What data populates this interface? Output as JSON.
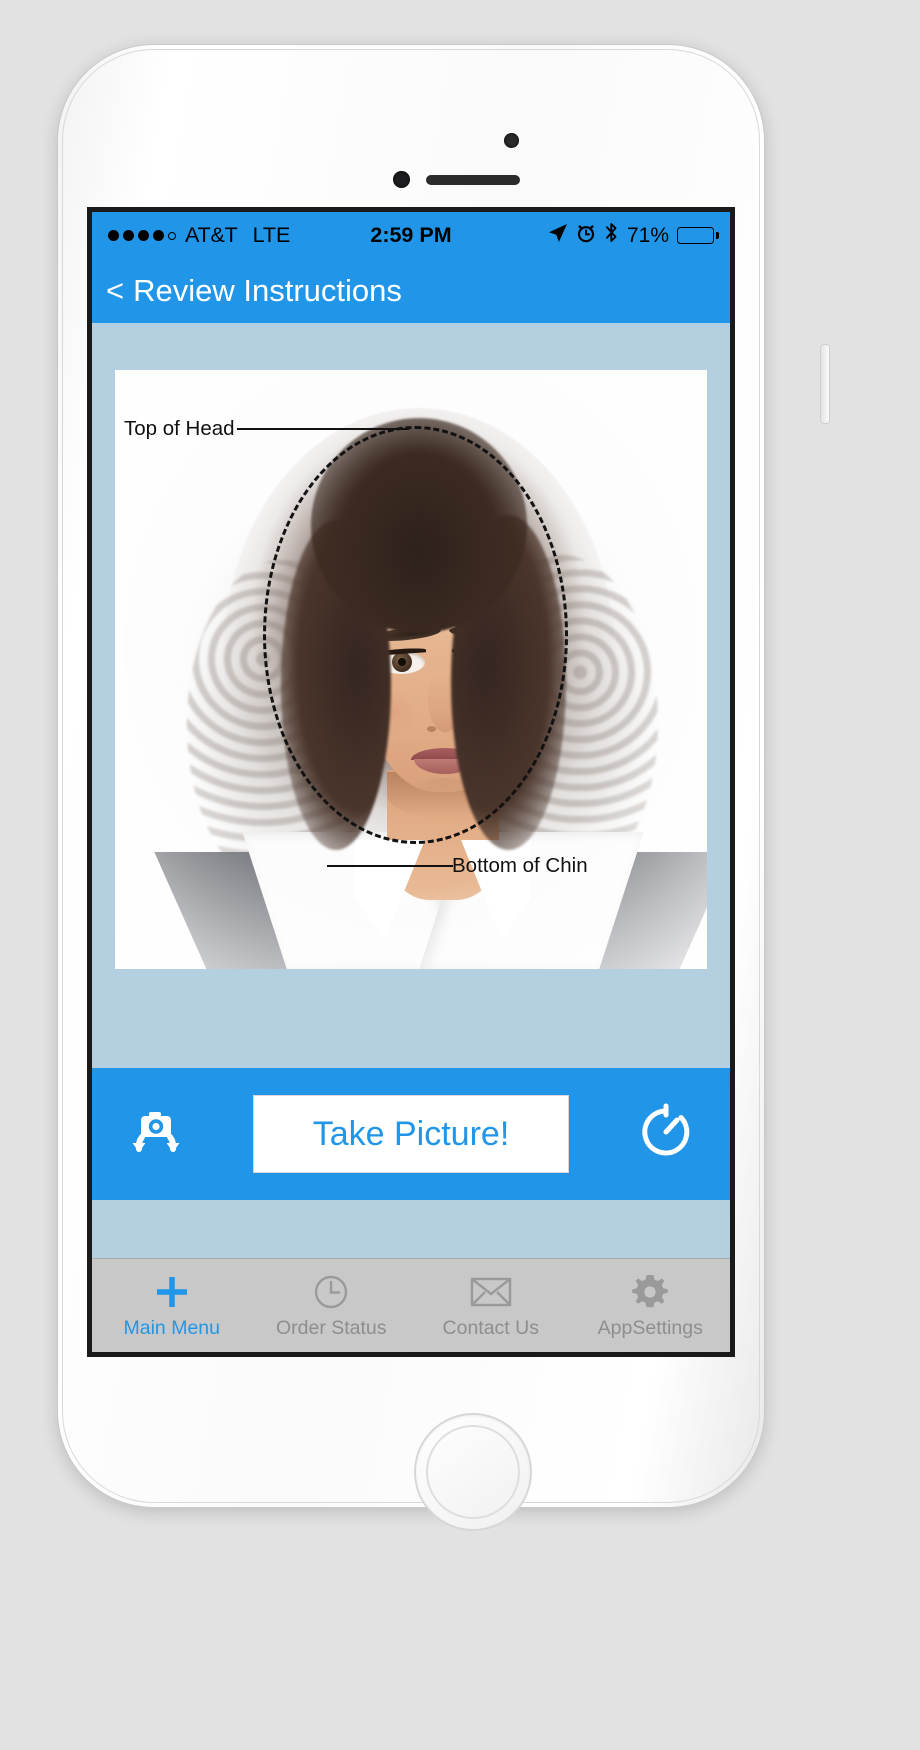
{
  "status_bar": {
    "signal_dots_filled": 4,
    "signal_dots_total": 5,
    "carrier": "AT&T",
    "network_type": "LTE",
    "time": "2:59 PM",
    "location_icon": "location-arrow-icon",
    "alarm_icon": "alarm-clock-icon",
    "bluetooth_icon": "bluetooth-icon",
    "battery_percent": "71%",
    "battery_level": 71
  },
  "nav_bar": {
    "back_chevron": "<",
    "title": "Review Instructions"
  },
  "photo": {
    "annotations": {
      "top_of_head": "Top of Head",
      "bottom_of_chin": "Bottom of Chin"
    }
  },
  "action_bar": {
    "switch_camera_icon": "switch-camera-icon",
    "take_picture_label": "Take Picture!",
    "timer_icon": "timer-icon"
  },
  "tab_bar": {
    "tabs": [
      {
        "label": "Main Menu",
        "icon": "plus-icon",
        "active": true
      },
      {
        "label": "Order Status",
        "icon": "clock-icon",
        "active": false
      },
      {
        "label": "Contact Us",
        "icon": "envelope-icon",
        "active": false
      },
      {
        "label": "AppSettings",
        "icon": "gear-icon",
        "active": false
      }
    ]
  },
  "colors": {
    "accent_blue": "#2196e8",
    "screen_background": "#b4cfe0",
    "tab_bar_background": "#c8c8c8",
    "inactive_tab_text": "#8e8e8e"
  }
}
